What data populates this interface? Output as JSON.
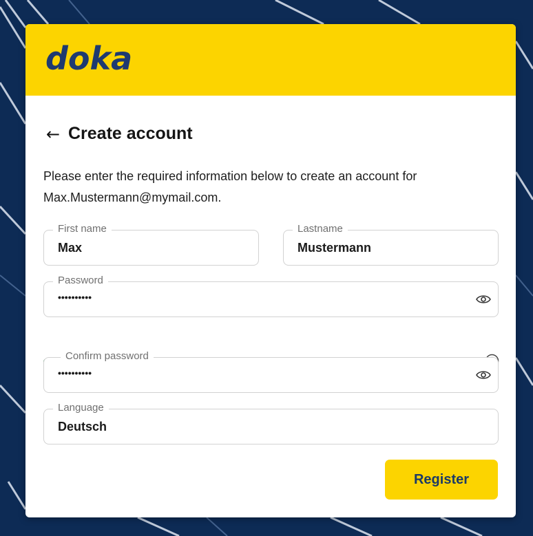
{
  "brand": {
    "logo_text": "doka",
    "logo_color": "#1e3a70",
    "accent_color": "#fcd400"
  },
  "page": {
    "title": "Create account",
    "back_icon": "arrow-left-icon",
    "description": "Please enter the required information below to create an account for Max.Mustermann@mymail.com."
  },
  "form": {
    "first_name": {
      "label": "First name",
      "value": "Max"
    },
    "last_name": {
      "label": "Lastname",
      "value": "Mustermann"
    },
    "password": {
      "label": "Password",
      "value": "••••••••••"
    },
    "password_strength": {
      "level": 1.0,
      "color": "#2e8b48"
    },
    "confirm_password": {
      "label": "Confirm password",
      "value": "••••••••••"
    },
    "language": {
      "label": "Language",
      "value": "Deutsch"
    },
    "register_label": "Register"
  }
}
